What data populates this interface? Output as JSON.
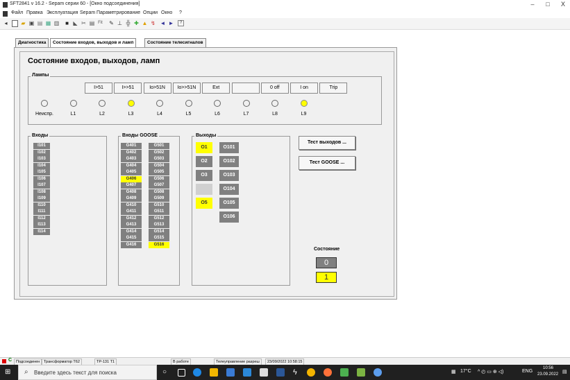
{
  "window": {
    "title": "SFT2841 v 16.2 - Sepam серии 60 - [Окно подсоединения]",
    "controls": [
      "–",
      "□",
      "X"
    ]
  },
  "menu": [
    "Файл",
    "Правка",
    "Эксплуатация",
    "Sepam",
    "Параметрирование",
    "Опции",
    "Окно",
    "?"
  ],
  "tabs": [
    "Диагностика",
    "Состояние входов, выходов и ламп",
    "Состояние телесигналов"
  ],
  "active_tab": 1,
  "page_title": "Состояние входов, выходов, ламп",
  "lamps": {
    "legend": "Лампы",
    "headers": [
      "I>51",
      "I>>51",
      "Io>51N",
      "Io>>51N",
      "Ext",
      "",
      "0 off",
      "I on",
      "Trip"
    ],
    "items": [
      {
        "name": "Неиспр.",
        "on": false
      },
      {
        "name": "L1",
        "on": false
      },
      {
        "name": "L2",
        "on": false
      },
      {
        "name": "L3",
        "on": true
      },
      {
        "name": "L4",
        "on": false
      },
      {
        "name": "L5",
        "on": false
      },
      {
        "name": "L6",
        "on": false
      },
      {
        "name": "L7",
        "on": false
      },
      {
        "name": "L8",
        "on": false
      },
      {
        "name": "L9",
        "on": true
      }
    ]
  },
  "inputs": {
    "legend": "Входы",
    "items": [
      "I101",
      "I102",
      "I103",
      "I104",
      "I105",
      "I106",
      "I107",
      "I108",
      "I109",
      "I110",
      "I111",
      "I112",
      "I113",
      "I114"
    ]
  },
  "goose": {
    "legend": "Входы GOOSE",
    "col1": [
      "G401",
      "G402",
      "G403",
      "G404",
      "G405",
      "G406",
      "G407",
      "G408",
      "G409",
      "G410",
      "G411",
      "G412",
      "G413",
      "G414",
      "G415",
      "G416"
    ],
    "col2": [
      "G501",
      "G502",
      "G503",
      "G504",
      "G505",
      "G506",
      "G507",
      "G508",
      "G509",
      "G510",
      "G511",
      "G512",
      "G513",
      "G514",
      "G515",
      "G516"
    ],
    "on": [
      "G406",
      "G516"
    ]
  },
  "outputs": {
    "legend": "Выходы",
    "col1": [
      {
        "label": "O1",
        "state": "on"
      },
      {
        "label": "O2",
        "state": "off"
      },
      {
        "label": "O3",
        "state": "off"
      },
      {
        "label": "",
        "state": "empty"
      },
      {
        "label": "O5",
        "state": "on"
      }
    ],
    "col2": [
      "O101",
      "O102",
      "O103",
      "O104",
      "O105",
      "O106"
    ]
  },
  "buttons": {
    "test_outputs": "Тест выходов ...",
    "test_goose": "Тест GOOSE ..."
  },
  "state": {
    "label": "Состояние",
    "off_value": "0",
    "on_value": "1"
  },
  "status_bar": [
    "Подсоединен",
    "Трансформатор Т62",
    "ТР-131 Т1",
    "В работе",
    "Телеуправление разреш",
    "23/09/2022  10:58:15"
  ],
  "taskbar": {
    "search_placeholder": "Введите здесь текст для поиска",
    "weather": "17°C",
    "language": "ENG",
    "time": "10:56",
    "date": "23.09.2022"
  },
  "colors": {
    "on": "#ffff00",
    "off_cell": "#808080",
    "taskbar": "#202020"
  }
}
